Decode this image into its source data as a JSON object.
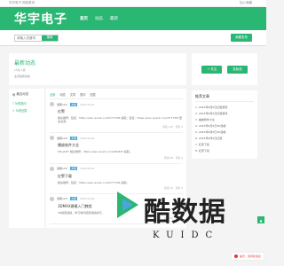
{
  "topbar": {
    "left": "华宇电子 网站首页",
    "right": "加入收藏"
  },
  "header": {
    "logo": "华宇电子",
    "nav": [
      "首页",
      "动态",
      "最新"
    ]
  },
  "search": {
    "placeholder": "请输入关键词",
    "button": "搜索"
  },
  "submit_label": "我要发布",
  "profile": {
    "title": "最新动态",
    "sub": "15位  1篇",
    "desc": "主页最新动态"
  },
  "buttons": {
    "follow": "+ 关注",
    "message": "发私信"
  },
  "side": {
    "head": "最近动态",
    "items": [
      "Ta的提问",
      "Ta的回答"
    ]
  },
  "tabs": [
    "全部",
    "动态",
    "文章",
    "提问",
    "回答"
  ],
  "posts": [
    {
      "author": "游客123",
      "tag": "文章",
      "date": "2023-04-01",
      "title": "红警",
      "body": "相关推荐：链接：https://pan.quark.cn/s/57774f4 提取：链接：https://pan.quark.cn/s/57774f4 更多资源。",
      "stats": "阅读 136 · 评论 0"
    },
    {
      "author": "游客123",
      "tag": "文章",
      "date": "2023-04-01",
      "title": "播放软件大全",
      "body": "DSLJCDT 相关推荐：https://pan.quark.cn/s/98467f 提取。",
      "stats": "阅读 98 · 评论 0"
    },
    {
      "author": "游客123",
      "tag": "文章",
      "date": "2023-04-01",
      "title": "红警下载",
      "body": "相关推荐：链接：https://pan.quark.cn/s/57774f4 提取。",
      "stats": "阅读 76 · 评论 0"
    },
    {
      "author": "游客123",
      "tag": "文章",
      "date": "2023-04-01",
      "title": "3DMAX建模入门教程",
      "body": "3D模型建模，学习软件使用建模技巧。",
      "stats": "阅读 54 · 评论 0"
    }
  ],
  "articles": {
    "head": "推荐文章",
    "items": [
      "1. 2023年6月5日红警游戏",
      "2. 2023年6月5日红警游戏",
      "3. 播放软件大全",
      "4. 2023年6月5日3D建模",
      "5. 2023年6月5日3D建模",
      "6. 2023年6月5日红警",
      "7. 红警下载",
      "8. 红警下载"
    ]
  },
  "watermark": {
    "text": "酷数据",
    "sub": "KUIDC"
  },
  "notice": "提示：您有新消息",
  "colors": {
    "brand": "#2ab673",
    "tag": "#4aa5e0",
    "alert": "#ee3333"
  }
}
